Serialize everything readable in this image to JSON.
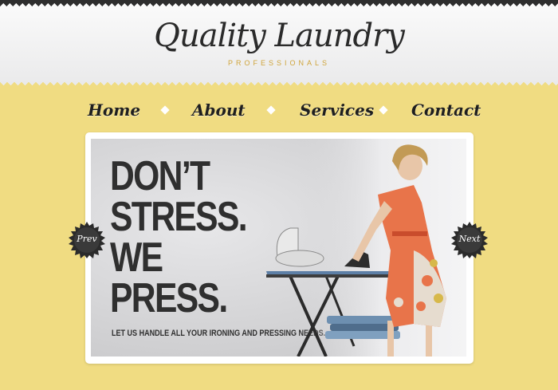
{
  "brand": {
    "title": "Quality Laundry",
    "subtitle": "PROFESSIONALS"
  },
  "nav": {
    "items": [
      {
        "label": "Home"
      },
      {
        "label": "About"
      },
      {
        "label": "Services"
      },
      {
        "label": "Contact"
      }
    ]
  },
  "slider": {
    "headline": [
      "DON’T",
      "STRESS.",
      "WE",
      "PRESS."
    ],
    "tagline": "LET US HANDLE ALL YOUR IRONING AND PRESSING NEEDS.",
    "prev_label": "Prev",
    "next_label": "Next"
  },
  "colors": {
    "background": "#f0dc82",
    "header": "#f1f1f2",
    "text_dark": "#2a2a2a",
    "accent_gold": "#cfa43a",
    "badge": "#2b2b2b"
  },
  "icons": {
    "nav_separator": "diamond-icon",
    "prev": "starburst-badge-icon",
    "next": "starburst-badge-icon"
  }
}
